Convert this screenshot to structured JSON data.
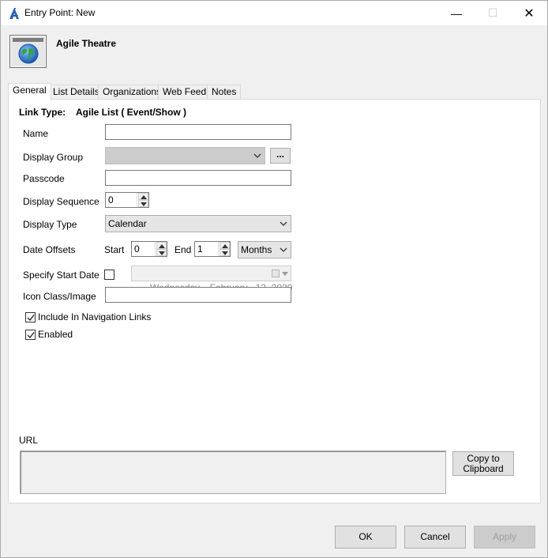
{
  "window": {
    "title": "Entry Point: New",
    "controls": {
      "minimize": "—",
      "maximize": "☐",
      "close": "✕"
    }
  },
  "header": {
    "title": "Agile Theatre",
    "icon": "globe-window-icon"
  },
  "tabs": [
    {
      "label": "General",
      "active": true
    },
    {
      "label": "List Details",
      "active": false
    },
    {
      "label": "Organizations",
      "active": false
    },
    {
      "label": "Web Feed",
      "active": false
    },
    {
      "label": "Notes",
      "active": false
    }
  ],
  "general": {
    "link_type_label": "Link Type:",
    "link_type_value": "Agile List ( Event/Show )",
    "name_label": "Name",
    "name_value": "",
    "display_group_label": "Display Group",
    "display_group_value": "",
    "browse_button": "...",
    "passcode_label": "Passcode",
    "passcode_value": "",
    "display_sequence_label": "Display Sequence",
    "display_sequence_value": "0",
    "display_type_label": "Display Type",
    "display_type_value": "Calendar",
    "date_offsets_label": "Date Offsets",
    "start_label": "Start",
    "start_value": "0",
    "end_label": "End",
    "end_value": "1",
    "offset_unit": "Months",
    "specify_start_date_label": "Specify Start Date",
    "specify_start_date_checked": false,
    "start_date_value": "Wednesday,   February   12, 2020",
    "icon_class_label": "Icon Class/Image",
    "icon_class_value": "",
    "include_nav_label": "Include In Navigation Links",
    "include_nav_checked": true,
    "enabled_label": "Enabled",
    "enabled_checked": true,
    "url_label": "URL",
    "url_value": "",
    "copy_button_line1": "Copy to",
    "copy_button_line2": "Clipboard"
  },
  "footer": {
    "ok": "OK",
    "cancel": "Cancel",
    "apply": "Apply"
  },
  "colors": {
    "accent": "#1e5fbf",
    "window_bg": "#f0f0f0",
    "panel_bg": "#ffffff"
  }
}
